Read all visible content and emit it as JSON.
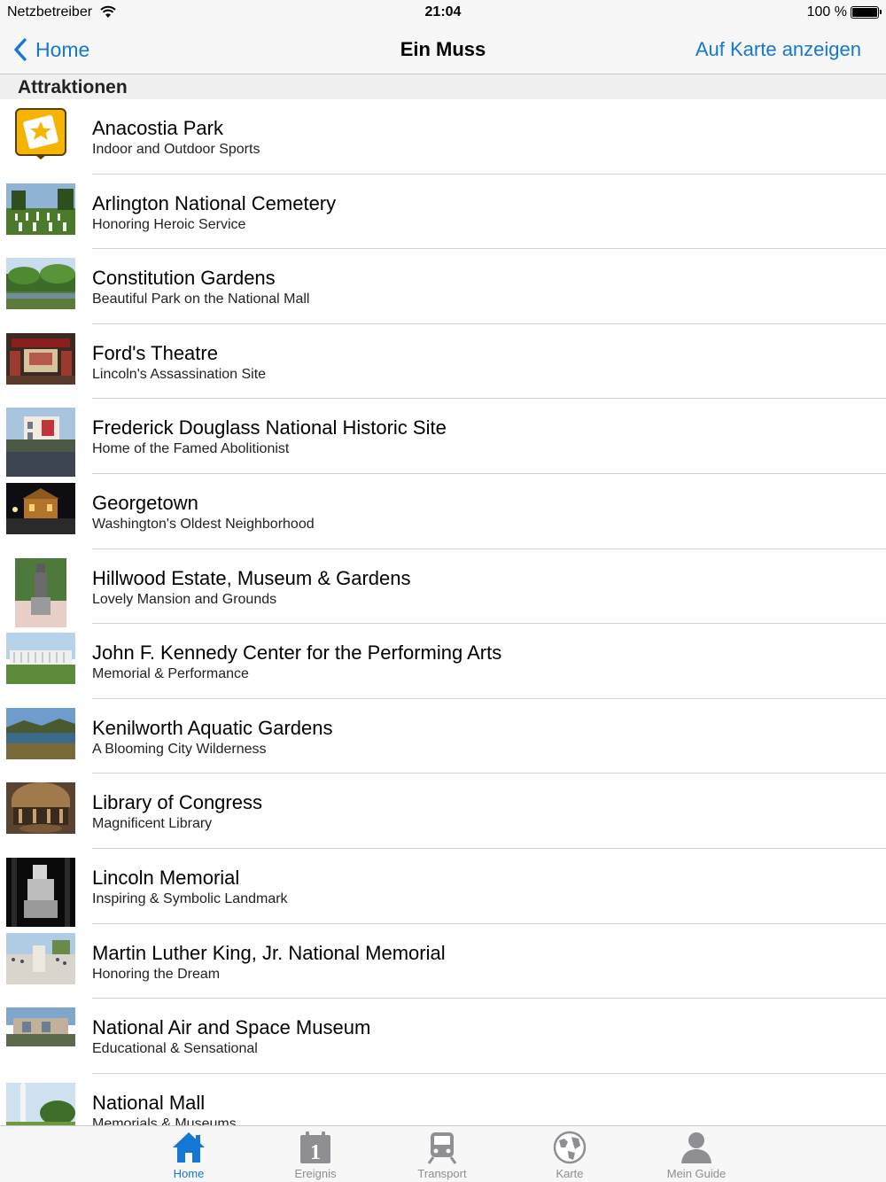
{
  "status_bar": {
    "carrier": "Netzbetreiber",
    "time": "21:04",
    "battery": "100 %"
  },
  "nav": {
    "back_label": "Home",
    "title": "Ein Muss",
    "right_label": "Auf Karte anzeigen"
  },
  "section_title": "Attraktionen",
  "items": [
    {
      "title": "Anacostia Park",
      "subtitle": "Indoor and Outdoor Sports",
      "thumb": "app-badge-icon"
    },
    {
      "title": "Arlington National Cemetery",
      "subtitle": "Honoring Heroic Service",
      "thumb": "cemetery-photo"
    },
    {
      "title": "Constitution Gardens",
      "subtitle": "Beautiful Park on the National Mall",
      "thumb": "garden-photo"
    },
    {
      "title": "Ford's Theatre",
      "subtitle": "Lincoln's Assassination Site",
      "thumb": "theatre-photo"
    },
    {
      "title": "Frederick Douglass National Historic Site",
      "subtitle": "Home of the Famed Abolitionist",
      "thumb": "house-photo"
    },
    {
      "title": "Georgetown",
      "subtitle": "Washington's Oldest Neighborhood",
      "thumb": "night-photo"
    },
    {
      "title": "Hillwood Estate, Museum & Gardens",
      "subtitle": "Lovely Mansion and Grounds",
      "thumb": "statue-photo"
    },
    {
      "title": "John F. Kennedy Center for the Performing Arts",
      "subtitle": "Memorial & Performance",
      "thumb": "kennedy-center-photo"
    },
    {
      "title": "Kenilworth Aquatic Gardens",
      "subtitle": "A Blooming City Wilderness",
      "thumb": "lake-photo"
    },
    {
      "title": "Library of Congress",
      "subtitle": "Magnificent Library",
      "thumb": "library-photo"
    },
    {
      "title": "Lincoln Memorial",
      "subtitle": "Inspiring & Symbolic Landmark",
      "thumb": "lincoln-photo"
    },
    {
      "title": "Martin Luther King, Jr. National Memorial",
      "subtitle": "Honoring the Dream",
      "thumb": "mlk-photo"
    },
    {
      "title": "National Air and Space Museum",
      "subtitle": "Educational & Sensational",
      "thumb": "museum-photo"
    },
    {
      "title": "National Mall",
      "subtitle": "Memorials & Museums",
      "thumb": "mall-photo"
    }
  ],
  "tabs": [
    {
      "label": "Home",
      "icon": "home-icon",
      "active": true
    },
    {
      "label": "Ereignis",
      "icon": "calendar-icon",
      "active": false
    },
    {
      "label": "Transport",
      "icon": "train-icon",
      "active": false
    },
    {
      "label": "Karte",
      "icon": "globe-icon",
      "active": false
    },
    {
      "label": "Mein Guide",
      "icon": "person-icon",
      "active": false
    }
  ],
  "colors": {
    "accent": "#1477d4",
    "inactive": "#8e8e93",
    "badge": "#f5b400"
  }
}
